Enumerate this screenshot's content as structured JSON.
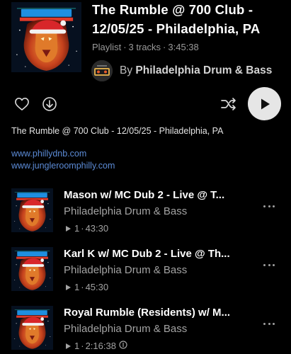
{
  "playlist": {
    "title": "The Rumble @ 700 Club - 12/05/25 - Philadelphia, PA",
    "type": "Playlist",
    "track_count": "3 tracks",
    "duration": "3:45:38",
    "by_label": "By",
    "owner": "Philadelphia Drum & Bass",
    "cover_icon": "rumble-lion-artwork"
  },
  "actions": {
    "like_icon": "heart-icon",
    "download_icon": "download-icon",
    "shuffle_icon": "shuffle-icon",
    "play_icon": "play-icon"
  },
  "description": {
    "text": "The Rumble @ 700 Club - 12/05/25 - Philadelphia, PA",
    "links": [
      "www.phillydnb.com",
      "www.jungleroomphilly.com"
    ]
  },
  "tracks": [
    {
      "title": "Mason w/ MC Dub 2 - Live @ T...",
      "artist": "Philadelphia Drum & Bass",
      "plays": "1",
      "duration": "43:30"
    },
    {
      "title": "Karl K w/ MC Dub 2 - Live @ Th...",
      "artist": "Philadelphia Drum & Bass",
      "plays": "1",
      "duration": "45:30"
    },
    {
      "title": "Royal Rumble (Residents) w/ M...",
      "artist": "Philadelphia Drum & Bass",
      "plays": "1",
      "duration": "2:16:38"
    }
  ],
  "colors": {
    "background": "#000000",
    "link": "#5c8bd6",
    "secondary_text": "#a3a3a3",
    "play_button": "#e6e6e6"
  }
}
